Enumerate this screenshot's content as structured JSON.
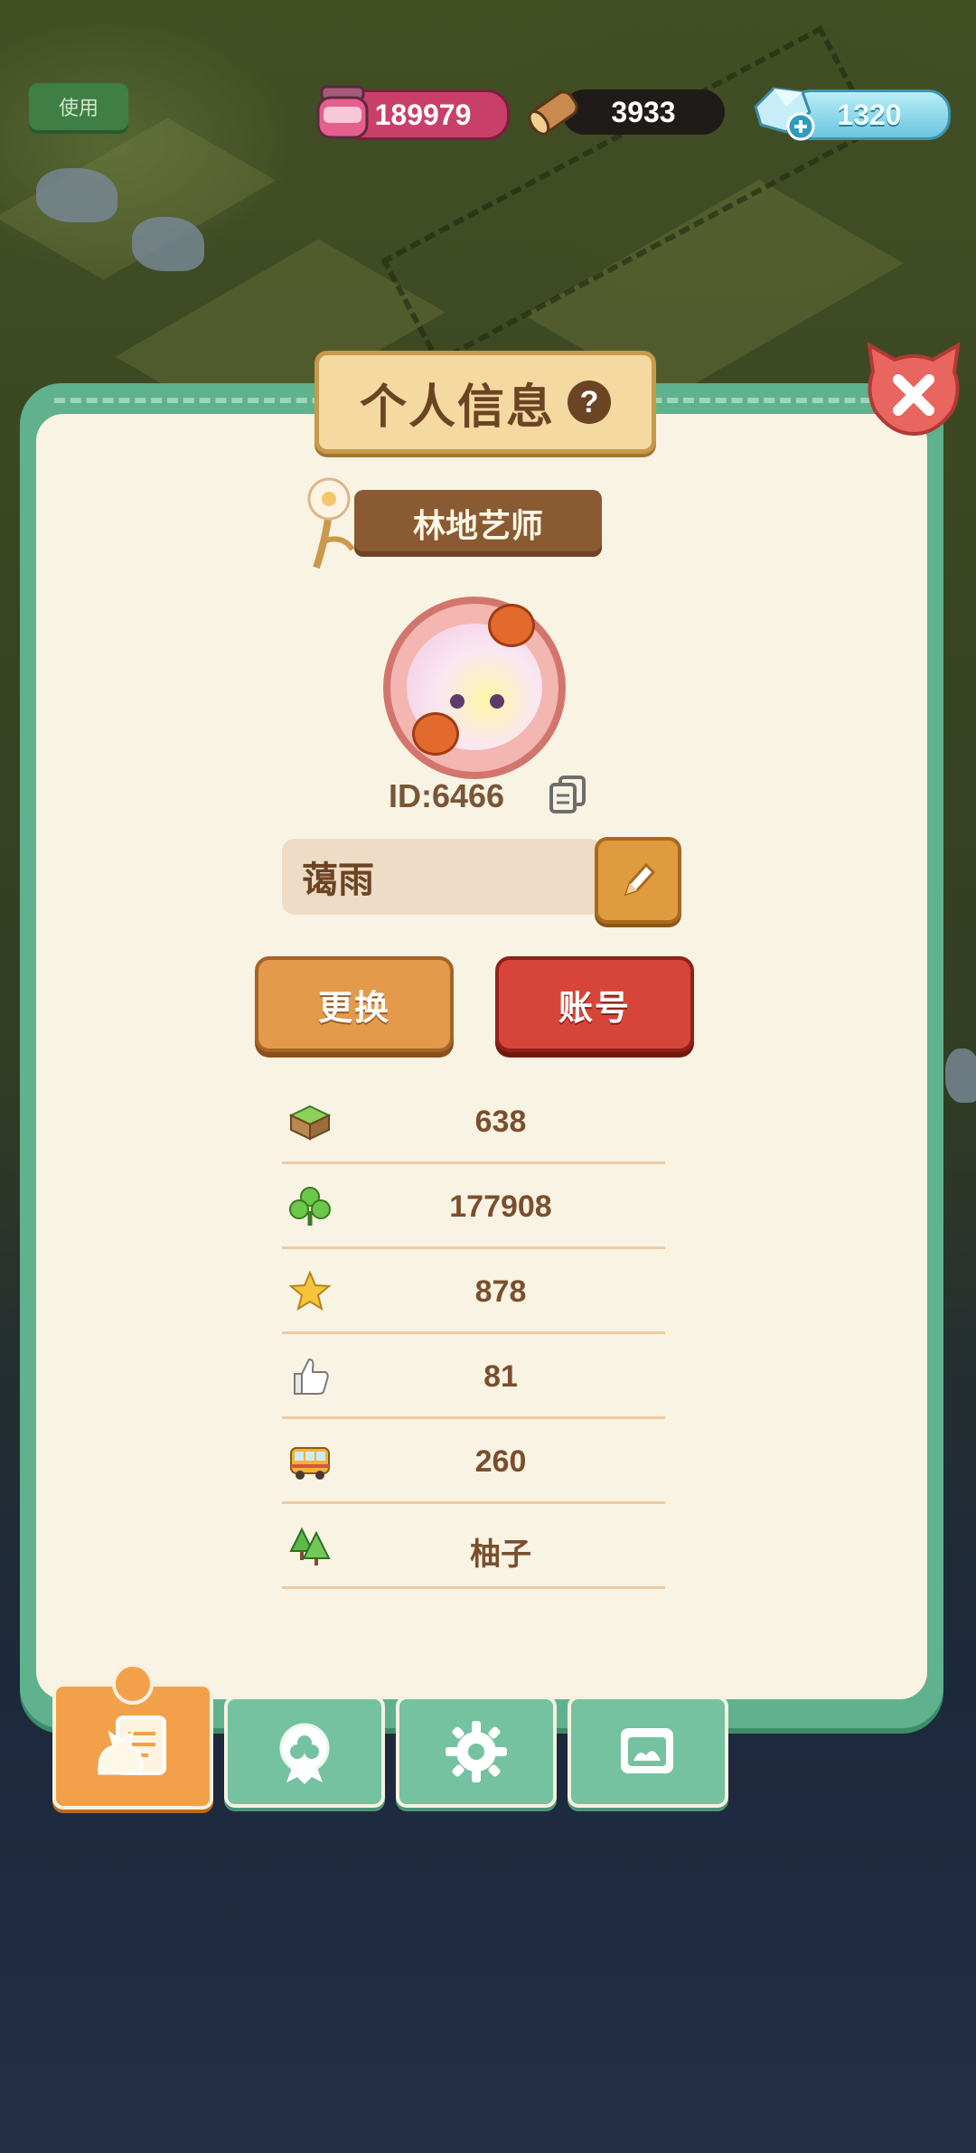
{
  "currency": {
    "jam": "189979",
    "wood": "3933",
    "gems": "1320"
  },
  "background": {
    "use_label": "使用"
  },
  "panel": {
    "title": "个人信息",
    "help_glyph": "?",
    "rank_title": "林地艺师",
    "player_id": "ID:6466",
    "nickname": "蔼雨",
    "change_label": "更换",
    "account_label": "账号"
  },
  "stats": [
    {
      "icon": "grass-block-icon",
      "value": "638"
    },
    {
      "icon": "clover-icon",
      "value": "177908"
    },
    {
      "icon": "star-icon",
      "value": "878"
    },
    {
      "icon": "thumbs-up-icon",
      "value": "81"
    },
    {
      "icon": "bus-icon",
      "value": "260"
    },
    {
      "icon": "pine-trees-icon",
      "value": "柚子"
    }
  ],
  "tabs": [
    {
      "icon": "profile-card-icon",
      "active": true
    },
    {
      "icon": "badge-icon",
      "active": false
    },
    {
      "icon": "gear-icon",
      "active": false
    },
    {
      "icon": "photo-album-icon",
      "active": false
    }
  ],
  "colors": {
    "panel_green": "#5fb28d",
    "panel_cream": "#f8f3e3",
    "text_brown": "#7a4f2e",
    "change_button": "#e39a4b",
    "account_button": "#d7453a"
  }
}
